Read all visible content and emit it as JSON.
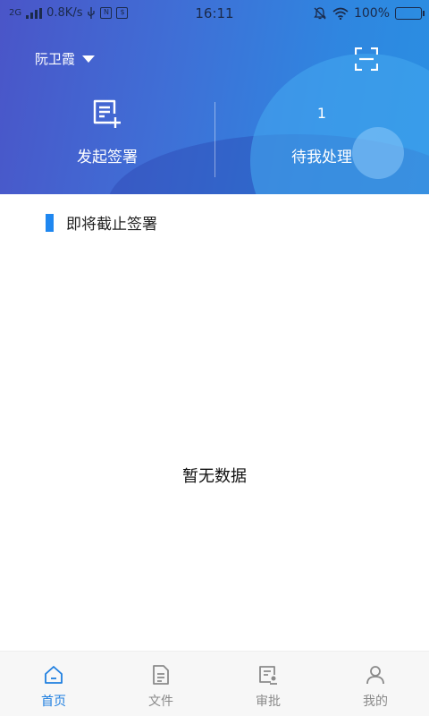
{
  "status_bar": {
    "network": "2G",
    "speed": "0.8K/s",
    "time": "16:11",
    "battery": "100%",
    "battery_level": 1.0
  },
  "header": {
    "user_name": "阮卫霞",
    "scan_icon": "scan-icon",
    "actions": [
      {
        "label": "发起签署",
        "icon": "doc-add-icon"
      },
      {
        "label": "待我处理",
        "count": "1"
      }
    ]
  },
  "section": {
    "title": "即将截止签署",
    "empty_text": "暂无数据"
  },
  "tabbar": {
    "tabs": [
      {
        "label": "首页",
        "icon": "home-icon",
        "active": true
      },
      {
        "label": "文件",
        "icon": "file-icon",
        "active": false
      },
      {
        "label": "审批",
        "icon": "approval-icon",
        "active": false
      },
      {
        "label": "我的",
        "icon": "user-icon",
        "active": false
      }
    ]
  },
  "colors": {
    "accent": "#1f7fe0",
    "header_start": "#4a55c8",
    "header_end": "#2a8fe2",
    "tab_inactive": "#8a8a8a"
  }
}
